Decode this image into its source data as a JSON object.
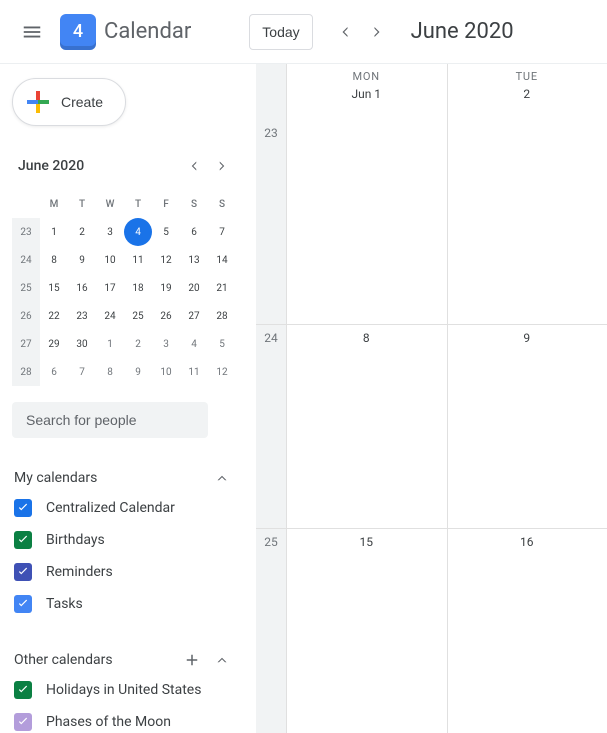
{
  "header": {
    "logo_day": "4",
    "app_name": "Calendar",
    "today_label": "Today",
    "month_label": "June 2020"
  },
  "create_label": "Create",
  "mini": {
    "title": "June 2020",
    "dow": [
      "M",
      "T",
      "W",
      "T",
      "F",
      "S",
      "S"
    ],
    "rows": [
      {
        "wk": "23",
        "days": [
          {
            "n": "1"
          },
          {
            "n": "2"
          },
          {
            "n": "3"
          },
          {
            "n": "4",
            "today": true
          },
          {
            "n": "5"
          },
          {
            "n": "6"
          },
          {
            "n": "7"
          }
        ]
      },
      {
        "wk": "24",
        "days": [
          {
            "n": "8"
          },
          {
            "n": "9"
          },
          {
            "n": "10"
          },
          {
            "n": "11"
          },
          {
            "n": "12"
          },
          {
            "n": "13"
          },
          {
            "n": "14"
          }
        ]
      },
      {
        "wk": "25",
        "days": [
          {
            "n": "15"
          },
          {
            "n": "16"
          },
          {
            "n": "17"
          },
          {
            "n": "18"
          },
          {
            "n": "19"
          },
          {
            "n": "20"
          },
          {
            "n": "21"
          }
        ]
      },
      {
        "wk": "26",
        "days": [
          {
            "n": "22"
          },
          {
            "n": "23"
          },
          {
            "n": "24"
          },
          {
            "n": "25"
          },
          {
            "n": "26"
          },
          {
            "n": "27"
          },
          {
            "n": "28"
          }
        ]
      },
      {
        "wk": "27",
        "days": [
          {
            "n": "29"
          },
          {
            "n": "30"
          },
          {
            "n": "1",
            "other": true
          },
          {
            "n": "2",
            "other": true
          },
          {
            "n": "3",
            "other": true
          },
          {
            "n": "4",
            "other": true
          },
          {
            "n": "5",
            "other": true
          }
        ]
      },
      {
        "wk": "28",
        "days": [
          {
            "n": "6",
            "other": true
          },
          {
            "n": "7",
            "other": true
          },
          {
            "n": "8",
            "other": true
          },
          {
            "n": "9",
            "other": true
          },
          {
            "n": "10",
            "other": true
          },
          {
            "n": "11",
            "other": true
          },
          {
            "n": "12",
            "other": true
          }
        ]
      }
    ]
  },
  "search_placeholder": "Search for people",
  "my_cal_title": "My calendars",
  "my_calendars": [
    {
      "label": "Centralized Calendar",
      "color": "#1a73e8"
    },
    {
      "label": "Birthdays",
      "color": "#0b8043"
    },
    {
      "label": "Reminders",
      "color": "#3f51b5"
    },
    {
      "label": "Tasks",
      "color": "#4285f4"
    }
  ],
  "other_cal_title": "Other calendars",
  "other_calendars": [
    {
      "label": "Holidays in United States",
      "color": "#0b8043"
    },
    {
      "label": "Phases of the Moon",
      "color": "#b39ddb"
    }
  ],
  "grid": {
    "columns": [
      {
        "dow": "MON",
        "first": "Jun 1"
      },
      {
        "dow": "TUE",
        "first": "2"
      }
    ],
    "rows": [
      {
        "wk": "23",
        "cells": [
          "",
          ""
        ]
      },
      {
        "wk": "24",
        "cells": [
          "8",
          "9"
        ]
      },
      {
        "wk": "25",
        "cells": [
          "15",
          "16"
        ]
      }
    ]
  }
}
